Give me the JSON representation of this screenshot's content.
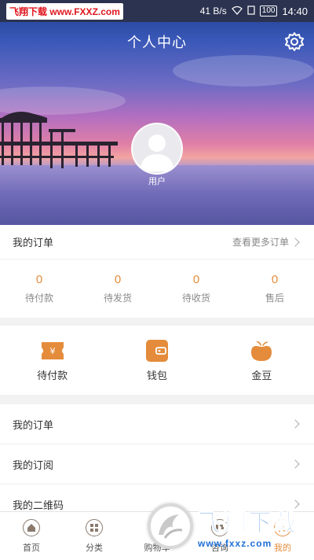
{
  "status_bar": {
    "watermark": "飞翔下载 www.FXXZ.com",
    "speed": "41 B/s",
    "battery": "100",
    "time": "14:40"
  },
  "header": {
    "title": "个人中心",
    "username": "用户"
  },
  "orders": {
    "title": "我的订单",
    "more": "查看更多订单",
    "items": [
      {
        "count": "0",
        "label": "待付款"
      },
      {
        "count": "0",
        "label": "待发货"
      },
      {
        "count": "0",
        "label": "待收货"
      },
      {
        "count": "0",
        "label": "售后"
      }
    ]
  },
  "quick_actions": [
    {
      "label": "待付款",
      "icon": "ticket-icon"
    },
    {
      "label": "钱包",
      "icon": "wallet-icon"
    },
    {
      "label": "金豆",
      "icon": "bean-icon"
    }
  ],
  "menu": [
    {
      "label": "我的订单"
    },
    {
      "label": "我的订阅"
    },
    {
      "label": "我的二维码"
    }
  ],
  "tabbar": [
    {
      "label": "首页",
      "icon": "home-icon"
    },
    {
      "label": "分类",
      "icon": "category-icon"
    },
    {
      "label": "购物车",
      "icon": "cart-icon"
    },
    {
      "label": "咨询",
      "icon": "chat-icon"
    },
    {
      "label": "我的",
      "icon": "profile-icon"
    }
  ],
  "watermark": {
    "logo_text": "飞翔下载",
    "url": "www.fxxz.com"
  },
  "colors": {
    "accent": "#e48c3b",
    "watermark_blue": "#1f6fd6"
  }
}
